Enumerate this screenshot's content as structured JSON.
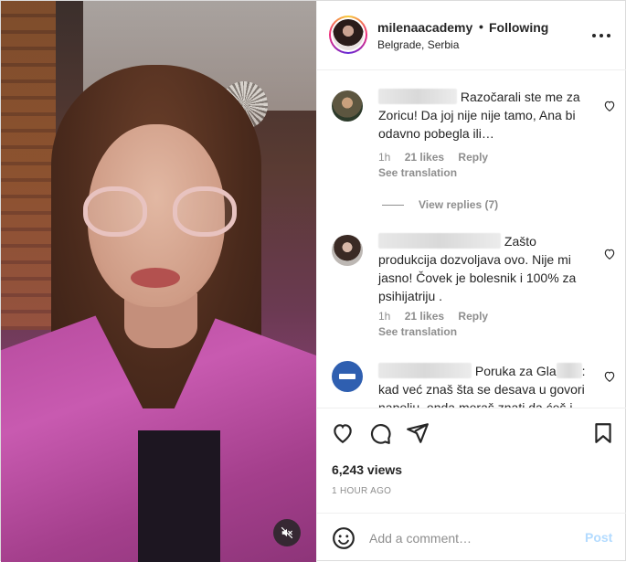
{
  "post": {
    "username": "milenaacademy",
    "separator": "•",
    "follow_status": "Following",
    "location": "Belgrade, Serbia",
    "views": "6,243 views",
    "timestamp": "1 HOUR AGO"
  },
  "comments": [
    {
      "text": "Razočarali ste me za Zoricu! Da joj nije nije tamo, Ana bi odavno pobegla ili…",
      "age": "1h",
      "likes": "21 likes",
      "reply": "Reply",
      "see_translation": "See translation",
      "view_replies": "View replies (7)"
    },
    {
      "text": "Zašto produkcija dozvoljava ovo. Nije mi jasno! Čovek je bolesnik i 100% za psihijatriju .",
      "age": "1h",
      "likes": "21 likes",
      "reply": "Reply",
      "see_translation": "See translation"
    },
    {
      "text_a": "Poruka za Gla",
      "text_b": ": kad već znaš šta se desava u govori napoliu, onda moraš znati da ćeš i"
    }
  ],
  "composer": {
    "placeholder": "Add a comment…",
    "post_label": "Post"
  },
  "colors": {
    "link_disabled": "#b3dbff",
    "muted": "#8e8e8e",
    "text": "#262626"
  },
  "icons": [
    "more-icon",
    "heart-icon",
    "comment-icon",
    "share-icon",
    "bookmark-icon",
    "emoji-icon",
    "muted-speaker-icon"
  ]
}
